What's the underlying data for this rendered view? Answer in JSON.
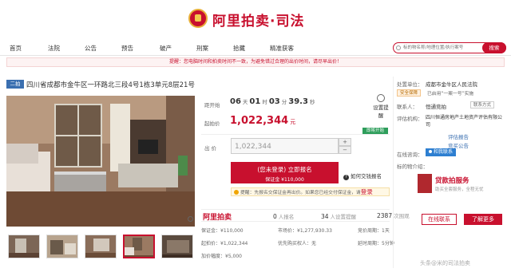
{
  "brand": {
    "name": "阿里拍卖·司法"
  },
  "nav": {
    "items": [
      "首页",
      "法院",
      "公告",
      "预告",
      "破产",
      "刑案",
      "拾藏",
      "精准获客"
    ]
  },
  "search": {
    "placeholder": "标的物名称/地理位置/执行案号",
    "button": "搜索"
  },
  "notice": {
    "text": "提醒：您电脑时间和拍卖时间不一致，为避免错过合理的出价时间，请尽早出价！"
  },
  "item": {
    "round": "二拍",
    "title": "四川省成都市金牛区一环路北三段4号1栋3单元8层21号",
    "photo_count": "5 thumbnails"
  },
  "auction": {
    "start_label": "距开始",
    "countdown": {
      "days": "06",
      "days_unit": "天",
      "hours": "01",
      "hours_unit": "时",
      "minutes": "03",
      "minutes_unit": "分",
      "seconds": "39.3",
      "seconds_unit": "秒"
    },
    "remind_label": "设置提醒",
    "start_price_label": "起拍价",
    "start_price": "1,022,344",
    "price_unit": "元",
    "status": "即将开始",
    "bid_label": "出 价",
    "bid_value": "1,022,344",
    "step_up": "+",
    "step_down": "−",
    "bid_button_line1": "(您未登录) 立即报名",
    "bid_button_line2": "保证金 ¥110,000",
    "howto": "如何交钱报名",
    "tip_text": "提醒：先报名交保证金再出价。如果您已经交付保证金，请",
    "tip_login": "登录"
  },
  "promo": {
    "logo": "阿里拍卖",
    "stats": [
      {
        "num": "0",
        "label": "人报名"
      },
      {
        "num": "34",
        "label": "人设置提醒"
      },
      {
        "num": "2387",
        "label": "次围观"
      }
    ]
  },
  "facts": {
    "deposit": "保证金：¥110,000",
    "market_price": "市场价：¥1,277,930.33",
    "bid_period": "竞价周期：1天",
    "start_price": "起拍价：¥1,022,344",
    "pay_time": "延时周期：5分钟",
    "increment": "加价幅度：¥5,000",
    "priority": "优先购买权人：无"
  },
  "sidebar": {
    "court_label": "处置单位：",
    "court_value": "成都市金牛区人民法院",
    "safety_tag": "安全保障",
    "safety_note": "已启用“一案一号”实施",
    "contact_label": "联系人：",
    "contact_value": "恒通竞拍",
    "contact_tag": "联系方式",
    "appraiser_label": "评估机构：",
    "appraiser_value": "四川恒通房地产土地资产评估有限公司",
    "report_link": "评估报告",
    "notice_label": "竞买公告",
    "chat_label": "在线咨询：",
    "chat_tag": "和我联系",
    "lot_label": "标的物介绍：",
    "service_title": "贷款拍服务",
    "service_sub": "助买全套服务，全程无忧",
    "online_btn": "在线联系",
    "more_btn": "了解更多"
  },
  "watermark": "头条@米的司法拍卖"
}
